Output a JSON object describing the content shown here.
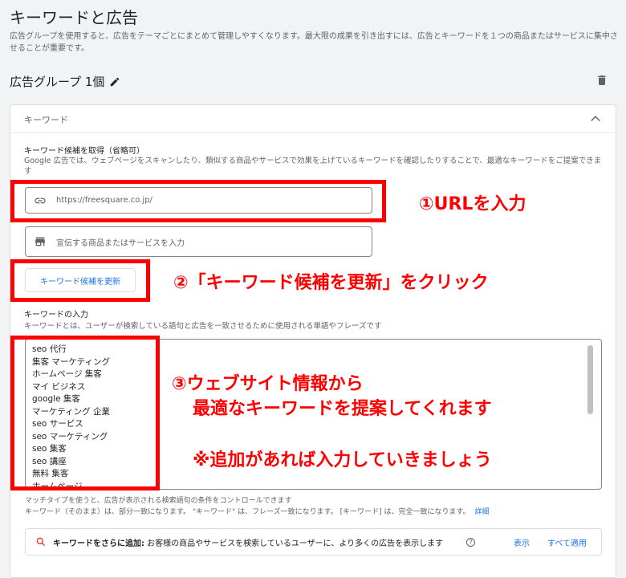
{
  "header": {
    "title": "キーワードと広告",
    "description": "広告グループを使用すると、広告をテーマごとにまとめて管理しやすくなります。最大限の成果を引き出すには、広告とキーワードを１つの商品またはサービスに集中させることが重要です。"
  },
  "ad_group": {
    "title": "広告グループ 1個",
    "edit_icon": "pencil-icon",
    "delete_icon": "trash-icon"
  },
  "keyword_card": {
    "header_label": "キーワード",
    "collapse_icon": "chevron-up-icon",
    "suggestions": {
      "title": "キーワード候補を取得（省略可）",
      "description": "Google 広告では、ウェブページをスキャンしたり、類似する商品やサービスで効果を上げているキーワードを確認したりすることで、最適なキーワードをご提案できます",
      "url_value": "https://freesquare.co.jp/",
      "product_placeholder": "宣伝する商品またはサービスを入力",
      "update_button": "キーワード候補を更新"
    },
    "keyword_input": {
      "title": "キーワードの入力",
      "description": "キーワードとは、ユーザーが検索している語句と広告を一致させるために使用される単語やフレーズです",
      "keywords": [
        "seo 代行",
        "集客 マーケティング",
        "ホームページ 集客",
        "マイ ビジネス",
        "google 集客",
        "マーケティング 企業",
        "seo サービス",
        "seo マーケティング",
        "seo 集客",
        "seo 講座",
        "無料 集客",
        "ホームページ"
      ]
    },
    "match_note_1": "マッチタイプを使うと、広告が表示される検索語句の条件をコントロールできます",
    "match_note_2": "キーワード（そのまま）は、部分一致になります。 \"キーワード\" は、フレーズ一致になります。 [キーワード] は、完全一致になります。",
    "match_note_link": "詳細",
    "add_more": {
      "bold": "キーワードをさらに追加:",
      "text": " お客様の商品やサービスを検索しているユーザーに、より多くの広告を表示します",
      "show_link": "表示",
      "apply_all_link": "すべて適用"
    }
  },
  "annotations": {
    "step1": "①URLを入力",
    "step2": "②「キーワード候補を更新」をクリック",
    "step3_line1": "③ウェブサイト情報から",
    "step3_line2": "最適なキーワードを提案してくれます",
    "step3_line3": "※追加があれば入力していきましょう"
  },
  "colors": {
    "annotation_red": "#ff0000",
    "link_blue": "#1a73e8"
  }
}
